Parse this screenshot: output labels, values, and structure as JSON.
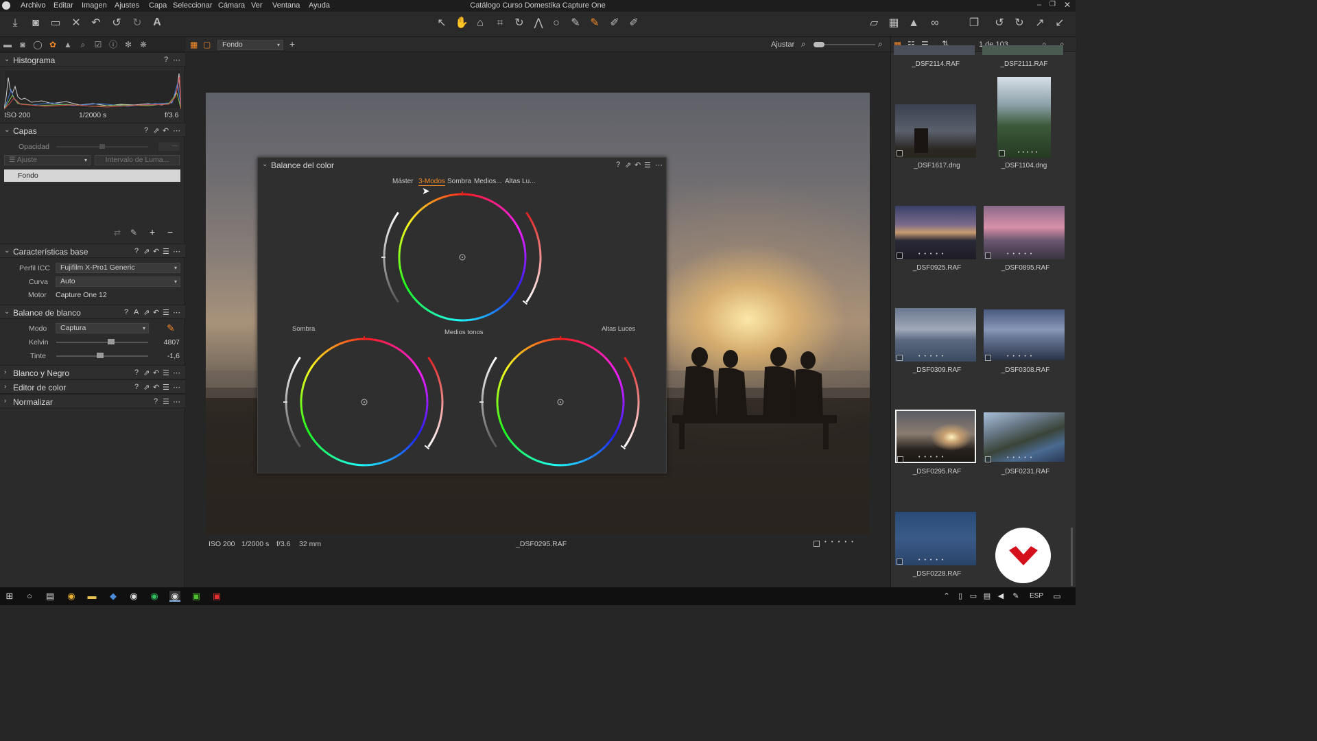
{
  "menubar": {
    "items": [
      "Archivo",
      "Editar",
      "Imagen",
      "Ajustes",
      "Capa",
      "Seleccionar",
      "Cámara",
      "Ver",
      "Ventana",
      "Ayuda"
    ],
    "window_title": "Catálogo Curso Domestika Capture One"
  },
  "histogram": {
    "title": "Histograma",
    "iso": "ISO 200",
    "shutter": "1/2000 s",
    "aperture": "f/3.6"
  },
  "layers": {
    "title": "Capas",
    "opacity_label": "Opacidad",
    "adjust_label": "Ajuste",
    "luma_label": "Intervalo de Luma...",
    "layer_name": "Fondo"
  },
  "base": {
    "title": "Características base",
    "icc_label": "Perfil ICC",
    "icc_value": "Fujifilm X-Pro1 Generic",
    "curve_label": "Curva",
    "curve_value": "Auto",
    "engine_label": "Motor",
    "engine_value": "Capture One 12"
  },
  "wb": {
    "title": "Balance de blanco",
    "mode_label": "Modo",
    "mode_value": "Captura",
    "kelvin_label": "Kelvin",
    "kelvin_value": "4807",
    "kelvin_level": 0.6,
    "tint_label": "Tinte",
    "tint_value": "-1,6",
    "tint_level": 0.48
  },
  "collapsed_sections": [
    "Blanco y Negro",
    "Editor de color",
    "Normalizar"
  ],
  "viewer": {
    "layer_select": "Fondo",
    "fit_label": "Ajustar",
    "status_iso": "ISO 200",
    "status_shutter": "1/2000 s",
    "status_aperture": "f/3.6",
    "status_focal": "32 mm",
    "status_filename": "_DSF0295.RAF"
  },
  "color_balance": {
    "title": "Balance del color",
    "tabs": [
      "Máster",
      "3-Modos",
      "Sombra",
      "Medios...",
      "Altas Lu..."
    ],
    "active_tab": "3-Modos",
    "shadow_label": "Sombra",
    "mid_label": "Medios tonos",
    "high_label": "Altas Luces"
  },
  "browser": {
    "count": "1 de 103",
    "thumbnails": [
      {
        "name": "_DSF2114.RAF"
      },
      {
        "name": "_DSF2111.RAF"
      },
      {
        "name": "_DSF1617.dng"
      },
      {
        "name": "_DSF1104.dng"
      },
      {
        "name": "_DSF0925.RAF"
      },
      {
        "name": "_DSF0895.RAF"
      },
      {
        "name": "_DSF0309.RAF"
      },
      {
        "name": "_DSF0308.RAF"
      },
      {
        "name": "_DSF0295.RAF"
      },
      {
        "name": "_DSF0231.RAF"
      },
      {
        "name": "_DSF0228.RAF"
      }
    ]
  },
  "taskbar": {
    "lang": "ESP"
  },
  "colors": {
    "accent": "#f0882a",
    "panel_bg": "#2b2b2b",
    "viewer_bg": "#262626"
  }
}
